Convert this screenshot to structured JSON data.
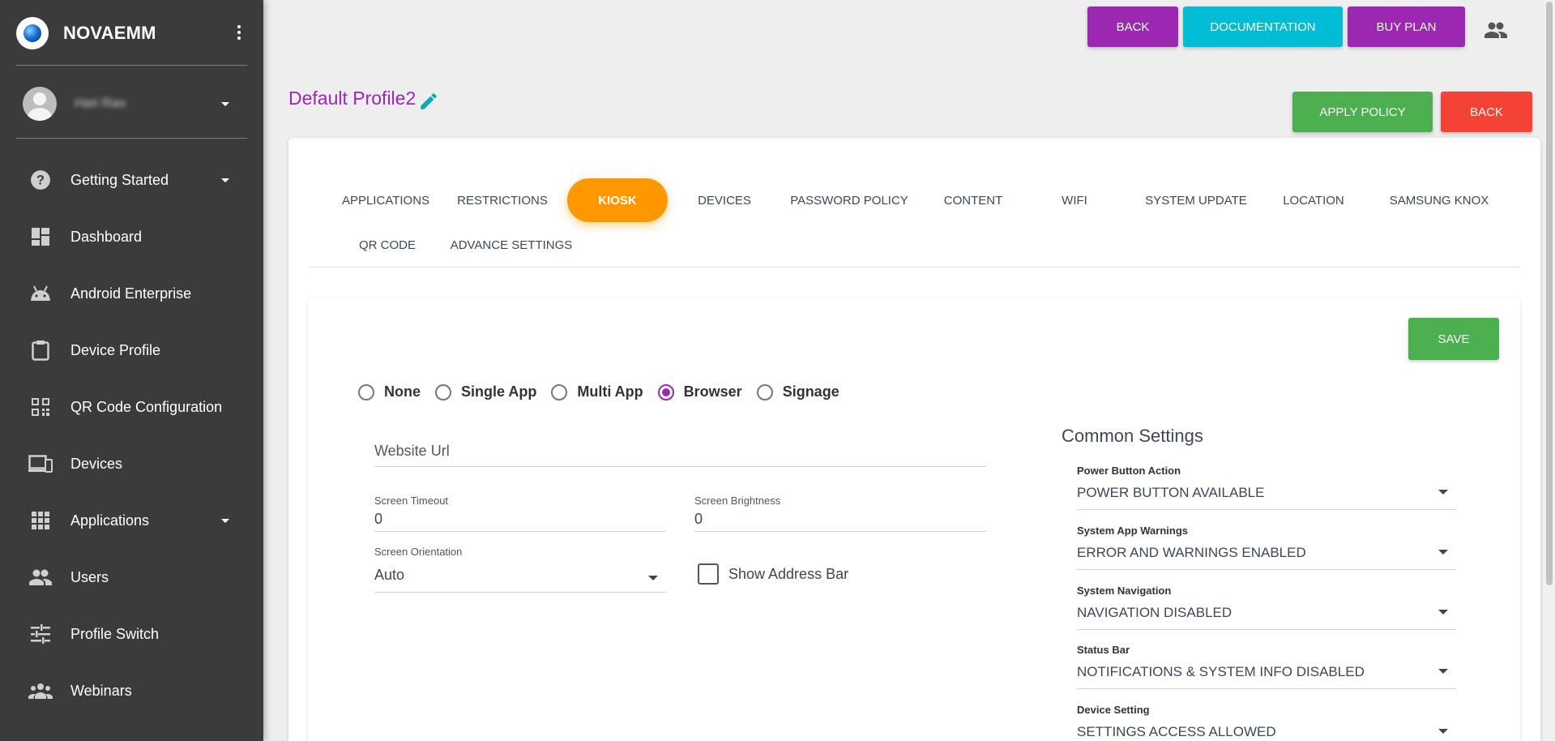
{
  "sidebar": {
    "brand": "NOVAEMM",
    "user_name": "Hari Rao",
    "items": [
      {
        "label": "Getting Started",
        "icon": "help-circle-icon",
        "has_caret": true
      },
      {
        "label": "Dashboard",
        "icon": "dashboard-icon",
        "has_caret": false
      },
      {
        "label": "Android Enterprise",
        "icon": "android-icon",
        "has_caret": false
      },
      {
        "label": "Device Profile",
        "icon": "clipboard-icon",
        "has_caret": false
      },
      {
        "label": "QR Code Configuration",
        "icon": "qr-code-icon",
        "has_caret": false
      },
      {
        "label": "Devices",
        "icon": "devices-icon",
        "has_caret": false
      },
      {
        "label": "Applications",
        "icon": "apps-grid-icon",
        "has_caret": true
      },
      {
        "label": "Users",
        "icon": "users-icon",
        "has_caret": false
      },
      {
        "label": "Profile Switch",
        "icon": "tune-icon",
        "has_caret": false
      },
      {
        "label": "Webinars",
        "icon": "group-icon",
        "has_caret": false
      }
    ]
  },
  "topbar": {
    "back": "BACK",
    "documentation": "DOCUMENTATION",
    "buy_plan": "BUY PLAN"
  },
  "profile": {
    "title": "Default Profile2",
    "apply_policy": "APPLY POLICY",
    "back": "BACK"
  },
  "tabs": {
    "row1": [
      "APPLICATIONS",
      "RESTRICTIONS",
      "KIOSK",
      "DEVICES",
      "PASSWORD POLICY",
      "CONTENT",
      "WIFI",
      "SYSTEM UPDATE",
      "LOCATION",
      "SAMSUNG KNOX"
    ],
    "row2": [
      "QR CODE",
      "ADVANCE SETTINGS"
    ],
    "active": "KIOSK"
  },
  "kiosk": {
    "save": "SAVE",
    "modes": [
      "None",
      "Single App",
      "Multi App",
      "Browser",
      "Signage"
    ],
    "selected_mode": "Browser",
    "website_url_placeholder": "Website Url",
    "screen_timeout_label": "Screen Timeout",
    "screen_timeout_value": "0",
    "screen_brightness_label": "Screen Brightness",
    "screen_brightness_value": "0",
    "screen_orientation_label": "Screen Orientation",
    "screen_orientation_value": "Auto",
    "show_address_bar_label": "Show Address Bar",
    "show_address_bar_checked": false
  },
  "common_settings": {
    "title": "Common Settings",
    "fields": [
      {
        "label": "Power Button Action",
        "value": "POWER BUTTON AVAILABLE"
      },
      {
        "label": "System App Warnings",
        "value": "ERROR AND WARNINGS ENABLED"
      },
      {
        "label": "System Navigation",
        "value": "NAVIGATION DISABLED"
      },
      {
        "label": "Status Bar",
        "value": "NOTIFICATIONS & SYSTEM INFO DISABLED"
      },
      {
        "label": "Device Setting",
        "value": "SETTINGS ACCESS ALLOWED"
      }
    ]
  },
  "colors": {
    "sidebar_bg": "#3b3b3c",
    "accent_purple": "#9c27b0",
    "accent_cyan": "#00bcd4",
    "active_tab": "#ff9800",
    "success": "#4caf50",
    "danger": "#f44336"
  }
}
